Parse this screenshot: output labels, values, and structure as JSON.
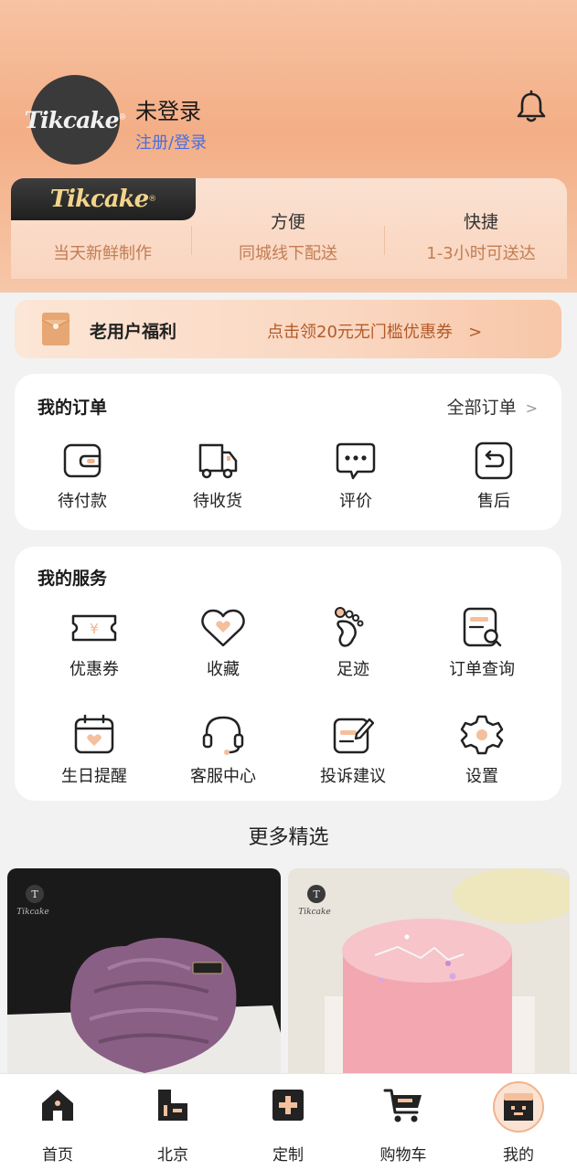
{
  "profile": {
    "login_status": "未登录",
    "login_link": "注册/登录",
    "avatar_logo": "Tikcake"
  },
  "features": {
    "logo": "Tikcake",
    "items": [
      {
        "title": "",
        "subtitle": "当天新鲜制作"
      },
      {
        "title": "方便",
        "subtitle": "同城线下配送"
      },
      {
        "title": "快捷",
        "subtitle": "1-3小时可送达"
      }
    ]
  },
  "welfare": {
    "title": "老用户福利",
    "promo": "点击领20元无门槛优惠券",
    "arrow": ">"
  },
  "orders": {
    "title": "我的订单",
    "all_label": "全部订单",
    "items": [
      {
        "label": "待付款",
        "icon": "wallet-icon"
      },
      {
        "label": "待收货",
        "icon": "delivery-truck-icon"
      },
      {
        "label": "评价",
        "icon": "comment-icon"
      },
      {
        "label": "售后",
        "icon": "return-icon"
      }
    ]
  },
  "services": {
    "title": "我的服务",
    "items": [
      {
        "label": "优惠券",
        "icon": "coupon-icon"
      },
      {
        "label": "收藏",
        "icon": "heart-icon"
      },
      {
        "label": "足迹",
        "icon": "footprint-icon"
      },
      {
        "label": "订单查询",
        "icon": "order-search-icon"
      },
      {
        "label": "生日提醒",
        "icon": "birthday-calendar-icon"
      },
      {
        "label": "客服中心",
        "icon": "headset-icon"
      },
      {
        "label": "投诉建议",
        "icon": "feedback-edit-icon"
      },
      {
        "label": "设置",
        "icon": "gear-icon"
      }
    ]
  },
  "more": {
    "title": "更多精选"
  },
  "products": [
    {
      "name": "",
      "image": "purple-rose-heart-cake",
      "logo": "Tikcake"
    },
    {
      "name": "",
      "image": "pink-constellation-cake",
      "logo": "Tikcake"
    }
  ],
  "tabbar": {
    "items": [
      {
        "label": "首页",
        "icon": "home-icon"
      },
      {
        "label": "北京",
        "icon": "city-icon"
      },
      {
        "label": "定制",
        "icon": "plus-box-icon"
      },
      {
        "label": "购物车",
        "icon": "cart-icon"
      },
      {
        "label": "我的",
        "icon": "profile-box-icon",
        "active": true
      }
    ]
  },
  "colors": {
    "accent": "#f3ae86",
    "link": "#4a6ee0",
    "promo": "#b35a2a",
    "peach": "#f8c6a8"
  }
}
